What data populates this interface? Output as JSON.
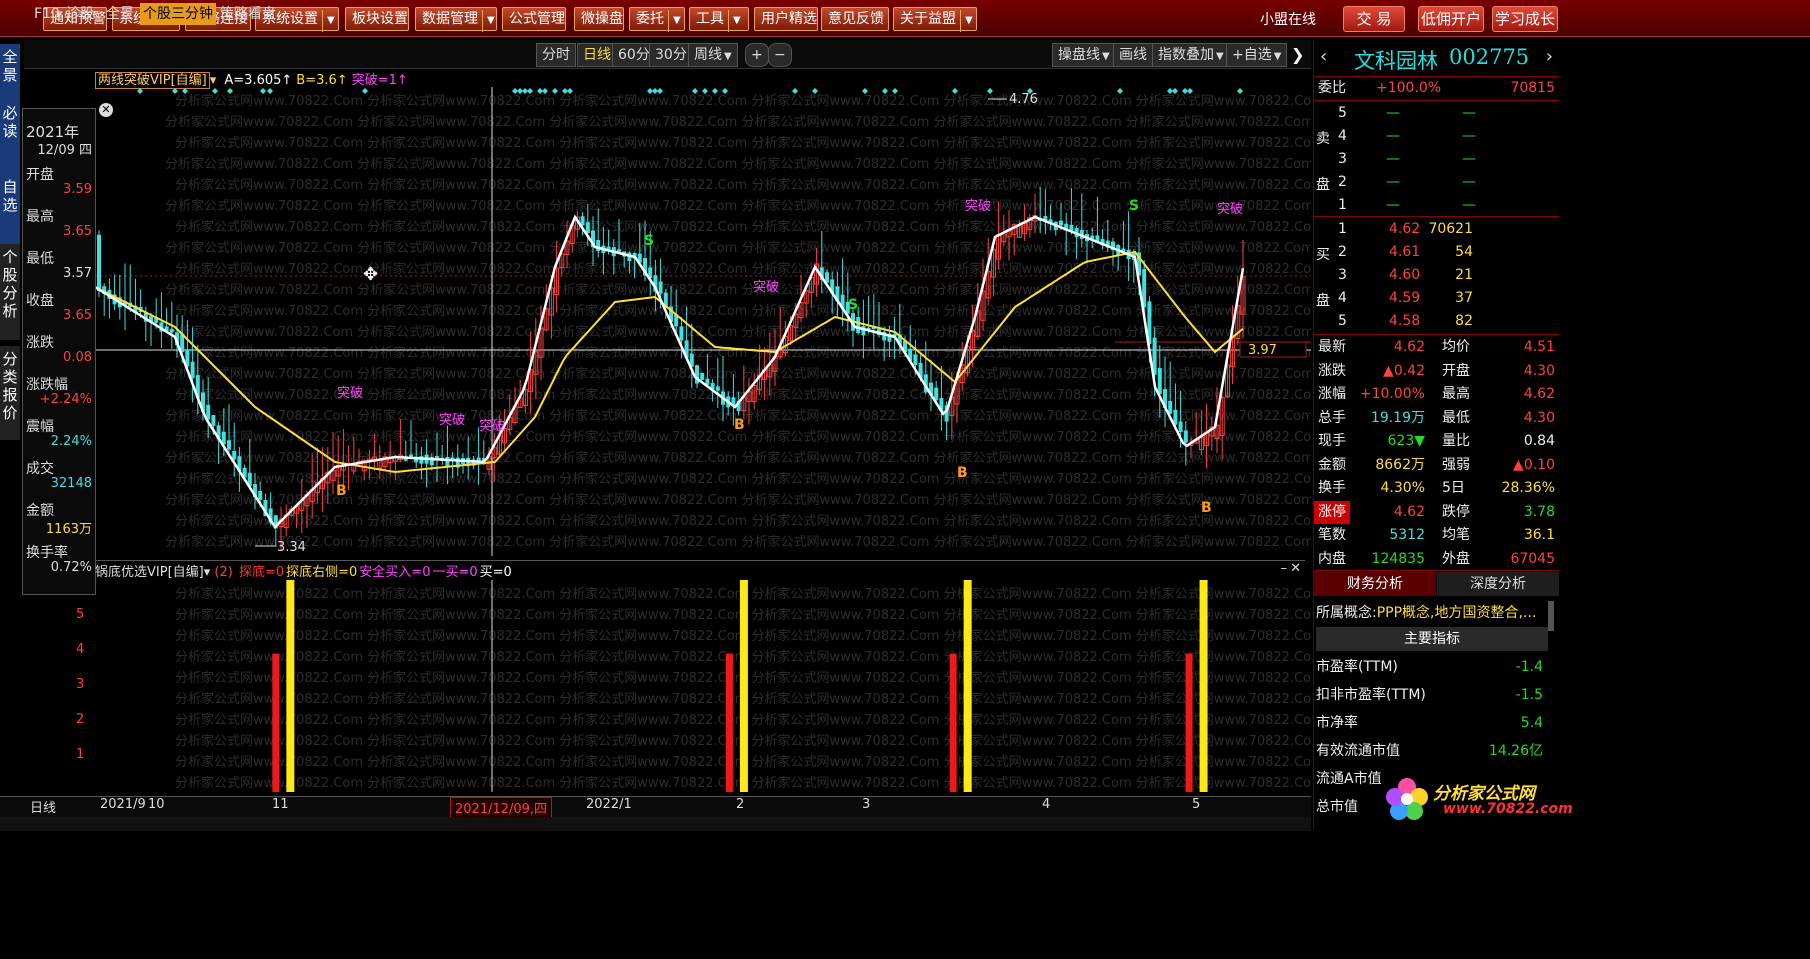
{
  "toolbar": {
    "buttons": [
      "通知预警",
      "系统预警",
      "网络连接",
      "系统设置",
      "板块设置",
      "数据管理",
      "公式管理",
      "微操盘",
      "委托",
      "工具",
      "用户精选",
      "意见反馈",
      "关于益盟"
    ],
    "dropdowns": [
      false,
      false,
      false,
      true,
      false,
      true,
      false,
      false,
      true,
      true,
      false,
      false,
      true
    ],
    "status": "小盟在线",
    "trade": "交 易",
    "open_account": "低佣开户",
    "learn": "学习成长"
  },
  "left_tabs": [
    "全景",
    "必读",
    "自选",
    "个股分析",
    "分类报价"
  ],
  "chart_tabs": {
    "items": [
      "F10",
      "诊股",
      "全景",
      "个股三分钟",
      "策略看盘"
    ],
    "active": "个股三分钟",
    "periods": [
      "分时",
      "日线",
      "60分",
      "30分",
      "周线"
    ],
    "active_period": "日线",
    "plus": "+",
    "minus": "−",
    "right": [
      "操盘线",
      "画线",
      "指数叠加",
      "+自选"
    ]
  },
  "indicator_main": {
    "name": "两线突破VIP[自编]",
    "params": [
      {
        "text": "A=3.605↑",
        "color": "#ffffff"
      },
      {
        "text": "B=3.6↑",
        "color": "#ffde3a"
      },
      {
        "text": "突破=1↑",
        "color": "#ff44ff"
      }
    ],
    "high_label": "4.76",
    "low_label": "3.34",
    "current_price_label": "3.97",
    "signal_labels": [
      "突破",
      "突破",
      "突破",
      "突破",
      "突破",
      "突破"
    ],
    "b_label": "B",
    "s_label": "S"
  },
  "indicator_sub": {
    "name": "锅底优选VIP[自编]",
    "num": "(2)",
    "params": [
      {
        "text": "探底=0",
        "color": "#ff3030"
      },
      {
        "text": "探底右侧=0",
        "color": "#ffde3a"
      },
      {
        "text": "安全买入=0",
        "color": "#ff44ff"
      },
      {
        "text": "一买=0",
        "color": "#ff44ff"
      },
      {
        "text": "买=0",
        "color": "#ffffff"
      }
    ],
    "y_ticks": [
      "5",
      "4",
      "3",
      "2",
      "1"
    ],
    "bars": [
      {
        "x": 0.159,
        "red": 4,
        "yellow": 6
      },
      {
        "x": 0.532,
        "red": 4,
        "yellow": 6
      },
      {
        "x": 0.716,
        "red": 4,
        "yellow": 6
      },
      {
        "x": 0.91,
        "red": 4,
        "yellow": 6
      }
    ]
  },
  "info_panel": {
    "year": "2021年",
    "date": "12/09 四",
    "rows": [
      {
        "label": "开盘",
        "value": "3.59",
        "color": "#ff4040"
      },
      {
        "label": "最高",
        "value": "3.65",
        "color": "#ff4040"
      },
      {
        "label": "最低",
        "value": "3.57",
        "color": "#ddd"
      },
      {
        "label": "收盘",
        "value": "3.65",
        "color": "#ff4040"
      },
      {
        "label": "涨跌",
        "value": "0.08",
        "color": "#ff4040"
      },
      {
        "label": "涨跌幅",
        "value": "+2.24%",
        "color": "#ff4040"
      },
      {
        "label": "震幅",
        "value": "2.24%",
        "color": "#3ee0e0"
      },
      {
        "label": "成交",
        "value": "32148",
        "color": "#3ee0e0"
      },
      {
        "label": "金额",
        "value": "1163万",
        "color": "#ffde3a"
      },
      {
        "label": "换手率",
        "value": "0.72%",
        "color": "#ddd"
      }
    ]
  },
  "price_axis": [
    "3.59",
    "3.65",
    "3.57",
    "3.65",
    "0.08"
  ],
  "x_axis": {
    "period_label": "日线",
    "labels": [
      "2021/9",
      "10",
      "11",
      "2021/12/09,四",
      "2022/1",
      "2",
      "3",
      "4",
      "5"
    ]
  },
  "stock": {
    "name": "文科园林",
    "code": "002775",
    "weibi_label": "委比",
    "weibi": "+100.0%",
    "weibi_vol": "70815",
    "sell_label": [
      "卖",
      "盘"
    ],
    "buy_label": [
      "买",
      "盘"
    ],
    "asks": [
      {
        "level": "5",
        "price": "—",
        "vol": "—"
      },
      {
        "level": "4",
        "price": "—",
        "vol": "—"
      },
      {
        "level": "3",
        "price": "—",
        "vol": "—"
      },
      {
        "level": "2",
        "price": "—",
        "vol": "—"
      },
      {
        "level": "1",
        "price": "—",
        "vol": "—"
      }
    ],
    "bids": [
      {
        "level": "1",
        "price": "4.62",
        "vol": "70621"
      },
      {
        "level": "2",
        "price": "4.61",
        "vol": "54"
      },
      {
        "level": "3",
        "price": "4.60",
        "vol": "21"
      },
      {
        "level": "4",
        "price": "4.59",
        "vol": "37"
      },
      {
        "level": "5",
        "price": "4.58",
        "vol": "82"
      }
    ],
    "quotes": [
      {
        "l": "最新",
        "v": "4.62",
        "vc": "#ff4040",
        "l2": "均价",
        "v2": "4.51",
        "vc2": "#ff4040"
      },
      {
        "l": "涨跌",
        "v": "▲0.42",
        "vc": "#ff4040",
        "l2": "开盘",
        "v2": "4.30",
        "vc2": "#ff4040"
      },
      {
        "l": "涨幅",
        "v": "+10.00%",
        "vc": "#ff4040",
        "l2": "最高",
        "v2": "4.62",
        "vc2": "#ff4040"
      },
      {
        "l": "总手",
        "v": "19.19万",
        "vc": "#3ee0e0",
        "l2": "最低",
        "v2": "4.30",
        "vc2": "#ff4040"
      },
      {
        "l": "现手",
        "v": "623▼",
        "vc": "#22dd22",
        "l2": "量比",
        "v2": "0.84",
        "vc2": "#eee"
      },
      {
        "l": "金额",
        "v": "8662万",
        "vc": "#ffde3a",
        "l2": "强弱",
        "v2": "▲0.10",
        "vc2": "#ff4040"
      },
      {
        "l": "换手",
        "v": "4.30%",
        "vc": "#ffde3a",
        "l2": "5日",
        "v2": "28.36%",
        "vc2": "#ffde3a"
      },
      {
        "l": "涨停",
        "v": "4.62",
        "vc": "#ff4040",
        "l2": "跌停",
        "v2": "3.78",
        "vc2": "#22dd22"
      },
      {
        "l": "笔数",
        "v": "5312",
        "vc": "#3ee0e0",
        "l2": "均笔",
        "v2": "36.1",
        "vc2": "#ffde3a"
      },
      {
        "l": "内盘",
        "v": "124835",
        "vc": "#22dd22",
        "l2": "外盘",
        "v2": "67045",
        "vc2": "#ff4040"
      }
    ],
    "tabs": [
      "财务分析",
      "深度分析"
    ],
    "concept_label": "所属概念:",
    "concept": "PPP概念,地方国资整合,...",
    "main_indicator": "主要指标",
    "fin": [
      {
        "l": "市盈率(TTM)",
        "v": "-1.4"
      },
      {
        "l": "扣非市盈率(TTM)",
        "v": "-1.5"
      },
      {
        "l": "市净率",
        "v": "5.4"
      },
      {
        "l": "有效流通市值",
        "v": "14.26亿"
      },
      {
        "l": "流通A市值",
        "v": ""
      },
      {
        "l": "总市值",
        "v": ""
      }
    ]
  },
  "logo": {
    "text": "分析家公式网",
    "url": "www.70822.com"
  },
  "watermark": "分析家公式网www.70822.Com",
  "colors": {
    "up": "#ff4040",
    "down": "#3ee0e0",
    "ma_white": "#ffffff",
    "ma_yellow": "#ffde3a",
    "signal": "#ff44ff"
  }
}
